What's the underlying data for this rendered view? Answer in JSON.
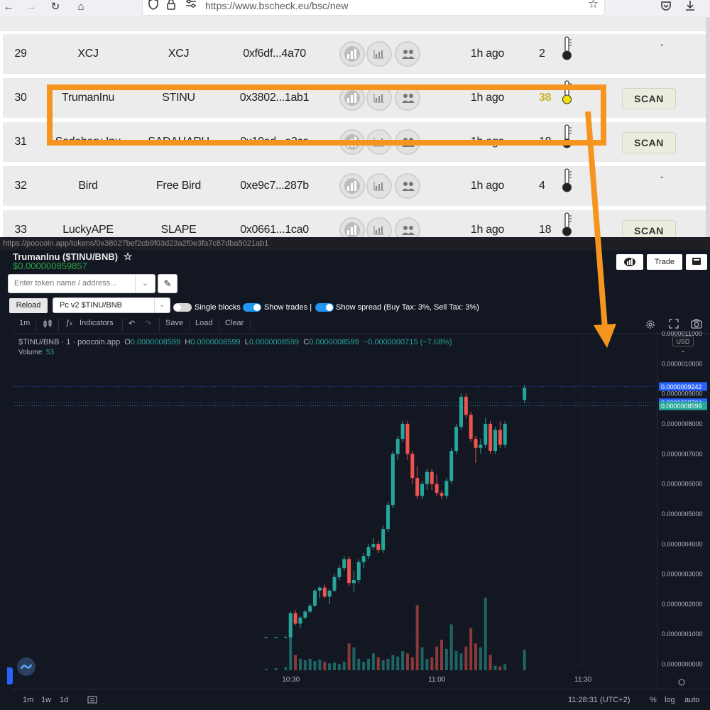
{
  "browser": {
    "url": "https://www.bscheck.eu/bsc/new"
  },
  "bscheck": {
    "rows": [
      {
        "num": "29",
        "name": "XCJ",
        "symbol": "XCJ",
        "address": "0xf6df...4a70",
        "age": "1h ago",
        "score": "2",
        "scan": "-"
      },
      {
        "num": "30",
        "name": "TrumanInu",
        "symbol": "STINU",
        "address": "0x3802...1ab1",
        "age": "1h ago",
        "score": "38",
        "scan": "SCAN"
      },
      {
        "num": "31",
        "name": "Sadaharu Inu",
        "symbol": "SADAHARU",
        "address": "0x10ad...a2ca",
        "age": "1h ago",
        "score": "18",
        "scan": "SCAN"
      },
      {
        "num": "32",
        "name": "Bird",
        "symbol": "Free Bird",
        "address": "0xe9c7...287b",
        "age": "1h ago",
        "score": "4",
        "scan": "-"
      },
      {
        "num": "33",
        "name": "LuckyAPE",
        "symbol": "SLAPE",
        "address": "0x0661...1ca0",
        "age": "1h ago",
        "score": "18",
        "scan": "SCAN"
      }
    ],
    "highlight_color": "#f5951f",
    "hot_score_color": "#c9b52a"
  },
  "poocoin": {
    "url": "https://poocoin.app/tokens/0x38027bef2cb9f03d23a2f0e3fa7c87dba5021ab1",
    "title": "TrumanInu ($TINU/BNB)",
    "price": "$0.000000859857",
    "token_search_placeholder": "Enter token name / address...",
    "reload_label": "Reload",
    "pair_selected": "Pc v2 $TINU/BNB",
    "toggles": [
      {
        "label": "Single blocks",
        "on": false
      },
      {
        "label": "Show trades |",
        "on": true
      },
      {
        "label": "Show spread (Buy Tax: 3%, Sell Tax: 3%)",
        "on": true
      }
    ],
    "trade_label": "Trade",
    "chart_toolbar": {
      "interval": "1m",
      "indicators": "Indicators",
      "save": "Save",
      "load": "Load",
      "clear": "Clear"
    },
    "legend": {
      "symbol": "$TINU/BNB · 1 · poocoin.app",
      "o_label": "O",
      "o": "0.0000008599",
      "h_label": "H",
      "h": "0.0000008599",
      "l_label": "L",
      "l": "0.0000008599",
      "c_label": "C",
      "c": "0.0000008599",
      "change": "−0.0000000715 (−7.68%)",
      "volume_label": "Volume",
      "volume": "53"
    },
    "currency": "USD",
    "bottom": {
      "ranges": [
        "1m",
        "1w",
        "1d"
      ],
      "clock": "11:28:31 (UTC+2)",
      "percent": "%",
      "log": "log",
      "auto": "auto"
    },
    "price_tags": [
      "0.0000009242",
      "0.0000008704",
      "0.0000008599"
    ],
    "colors": {
      "up": "#26a69a",
      "down": "#ef5350",
      "tag_blue": "#2962ff",
      "tag_green": "#26a69a"
    }
  },
  "chart_data": {
    "type": "candlestick",
    "y_tick_labels": [
      "0.0000011000",
      "0.0000010000",
      "0.0000009000",
      "0.0000008000",
      "0.0000007000",
      "0.0000006000",
      "0.0000005000",
      "0.0000004000",
      "0.0000003000",
      "0.0000002000",
      "0.0000001000",
      "0.0000000000"
    ],
    "ylim": [
      -2e-08,
      1.1e-06
    ],
    "x_tick_labels": [
      "10:30",
      "11:00",
      "11:30"
    ],
    "x_ticks_minutes": [
      0,
      30,
      60
    ],
    "xlim_minutes": [
      -57,
      75
    ],
    "candles": [
      {
        "t": -5,
        "o": 9e-08,
        "h": 9.2e-08,
        "l": 8.8e-08,
        "c": 9e-08,
        "v": 4
      },
      {
        "t": -3,
        "o": 9e-08,
        "h": 9.2e-08,
        "l": 8.8e-08,
        "c": 9e-08,
        "v": 5
      },
      {
        "t": -1,
        "o": 9e-08,
        "h": 9.5e-08,
        "l": 8.8e-08,
        "c": 9e-08,
        "v": 8
      },
      {
        "t": 0,
        "o": 9e-08,
        "h": 1.75e-07,
        "l": 9e-08,
        "c": 1.7e-07,
        "v": 110
      },
      {
        "t": 1,
        "o": 1.7e-07,
        "h": 1.8e-07,
        "l": 1.3e-07,
        "c": 1.35e-07,
        "v": 40
      },
      {
        "t": 2,
        "o": 1.35e-07,
        "h": 1.6e-07,
        "l": 1.2e-07,
        "c": 1.55e-07,
        "v": 30
      },
      {
        "t": 3,
        "o": 1.55e-07,
        "h": 1.8e-07,
        "l": 1.5e-07,
        "c": 1.75e-07,
        "v": 26
      },
      {
        "t": 4,
        "o": 1.75e-07,
        "h": 2e-07,
        "l": 1.7e-07,
        "c": 1.95e-07,
        "v": 30
      },
      {
        "t": 5,
        "o": 1.95e-07,
        "h": 2.5e-07,
        "l": 1.9e-07,
        "c": 2.45e-07,
        "v": 24
      },
      {
        "t": 6,
        "o": 2.45e-07,
        "h": 2.6e-07,
        "l": 2.2e-07,
        "c": 2.55e-07,
        "v": 28
      },
      {
        "t": 7,
        "o": 2.55e-07,
        "h": 2.65e-07,
        "l": 2.2e-07,
        "c": 2.25e-07,
        "v": 22
      },
      {
        "t": 8,
        "o": 2.25e-07,
        "h": 2.5e-07,
        "l": 2e-07,
        "c": 2.45e-07,
        "v": 18
      },
      {
        "t": 9,
        "o": 2.45e-07,
        "h": 3e-07,
        "l": 2.4e-07,
        "c": 2.9e-07,
        "v": 20
      },
      {
        "t": 10,
        "o": 2.9e-07,
        "h": 3.3e-07,
        "l": 2.8e-07,
        "c": 3.2e-07,
        "v": 16
      },
      {
        "t": 11,
        "o": 3.2e-07,
        "h": 3.6e-07,
        "l": 3.1e-07,
        "c": 3.5e-07,
        "v": 22
      },
      {
        "t": 12,
        "o": 3.5e-07,
        "h": 3.6e-07,
        "l": 2.6e-07,
        "c": 2.7e-07,
        "v": 70
      },
      {
        "t": 13,
        "o": 2.7e-07,
        "h": 3.1e-07,
        "l": 2.4e-07,
        "c": 2.8e-07,
        "v": 60
      },
      {
        "t": 14,
        "o": 2.8e-07,
        "h": 3.5e-07,
        "l": 2.7e-07,
        "c": 3.4e-07,
        "v": 30
      },
      {
        "t": 15,
        "o": 3.4e-07,
        "h": 3.7e-07,
        "l": 3.2e-07,
        "c": 3.6e-07,
        "v": 22
      },
      {
        "t": 16,
        "o": 3.6e-07,
        "h": 4e-07,
        "l": 3.5e-07,
        "c": 3.9e-07,
        "v": 30
      },
      {
        "t": 17,
        "o": 3.9e-07,
        "h": 4.2e-07,
        "l": 3.8e-07,
        "c": 4e-07,
        "v": 44
      },
      {
        "t": 18,
        "o": 4e-07,
        "h": 4.1e-07,
        "l": 3.7e-07,
        "c": 3.8e-07,
        "v": 34
      },
      {
        "t": 19,
        "o": 3.8e-07,
        "h": 4.6e-07,
        "l": 3.7e-07,
        "c": 4.5e-07,
        "v": 26
      },
      {
        "t": 20,
        "o": 4.5e-07,
        "h": 5.4e-07,
        "l": 4.4e-07,
        "c": 5.3e-07,
        "v": 30
      },
      {
        "t": 21,
        "o": 5.3e-07,
        "h": 7.1e-07,
        "l": 5.2e-07,
        "c": 7e-07,
        "v": 40
      },
      {
        "t": 22,
        "o": 7e-07,
        "h": 7.6e-07,
        "l": 6.8e-07,
        "c": 7.5e-07,
        "v": 36
      },
      {
        "t": 23,
        "o": 7.5e-07,
        "h": 8.1e-07,
        "l": 7.4e-07,
        "c": 8e-07,
        "v": 50
      },
      {
        "t": 24,
        "o": 8e-07,
        "h": 8.1e-07,
        "l": 6.8e-07,
        "c": 7e-07,
        "v": 44
      },
      {
        "t": 25,
        "o": 7e-07,
        "h": 7.1e-07,
        "l": 6e-07,
        "c": 6.2e-07,
        "v": 34
      },
      {
        "t": 26,
        "o": 6.2e-07,
        "h": 6.6e-07,
        "l": 5.5e-07,
        "c": 5.6e-07,
        "v": 170
      },
      {
        "t": 27,
        "o": 5.6e-07,
        "h": 6.1e-07,
        "l": 5.5e-07,
        "c": 6e-07,
        "v": 60
      },
      {
        "t": 28,
        "o": 6e-07,
        "h": 6.5e-07,
        "l": 5.8e-07,
        "c": 6.4e-07,
        "v": 30
      },
      {
        "t": 29,
        "o": 6.4e-07,
        "h": 6.5e-07,
        "l": 5.8e-07,
        "c": 6e-07,
        "v": 34
      },
      {
        "t": 30,
        "o": 6e-07,
        "h": 6.3e-07,
        "l": 5.6e-07,
        "c": 5.7e-07,
        "v": 62
      },
      {
        "t": 31,
        "o": 5.7e-07,
        "h": 5.8e-07,
        "l": 5.5e-07,
        "c": 5.6e-07,
        "v": 80
      },
      {
        "t": 32,
        "o": 5.6e-07,
        "h": 6.2e-07,
        "l": 5.5e-07,
        "c": 6.1e-07,
        "v": 56
      },
      {
        "t": 33,
        "o": 6.1e-07,
        "h": 7.2e-07,
        "l": 6e-07,
        "c": 7.1e-07,
        "v": 120
      },
      {
        "t": 34,
        "o": 7.1e-07,
        "h": 8e-07,
        "l": 7e-07,
        "c": 7.9e-07,
        "v": 50
      },
      {
        "t": 35,
        "o": 7.9e-07,
        "h": 9e-07,
        "l": 7.8e-07,
        "c": 8.9e-07,
        "v": 44
      },
      {
        "t": 36,
        "o": 8.9e-07,
        "h": 9e-07,
        "l": 8.2e-07,
        "c": 8.3e-07,
        "v": 62
      },
      {
        "t": 37,
        "o": 8.3e-07,
        "h": 8.4e-07,
        "l": 7.4e-07,
        "c": 7.5e-07,
        "v": 110
      },
      {
        "t": 38,
        "o": 7.5e-07,
        "h": 7.6e-07,
        "l": 6.7e-07,
        "c": 7.2e-07,
        "v": 70
      },
      {
        "t": 39,
        "o": 7.2e-07,
        "h": 7.5e-07,
        "l": 7e-07,
        "c": 7.3e-07,
        "v": 60
      },
      {
        "t": 40,
        "o": 7.3e-07,
        "h": 8.2e-07,
        "l": 7.2e-07,
        "c": 8e-07,
        "v": 190
      },
      {
        "t": 41,
        "o": 8e-07,
        "h": 8.1e-07,
        "l": 7e-07,
        "c": 7.1e-07,
        "v": 40
      },
      {
        "t": 42,
        "o": 7.1e-07,
        "h": 7.9e-07,
        "l": 7e-07,
        "c": 7.8e-07,
        "v": 12
      },
      {
        "t": 43,
        "o": 7.8e-07,
        "h": 8.1e-07,
        "l": 7.2e-07,
        "c": 7.3e-07,
        "v": 10
      },
      {
        "t": 44,
        "o": 7.3e-07,
        "h": 8.1e-07,
        "l": 7.2e-07,
        "c": 8e-07,
        "v": 16
      },
      {
        "t": 48,
        "o": 8.8e-07,
        "h": 9.3e-07,
        "l": 8.7e-07,
        "c": 9.2e-07,
        "v": 53
      }
    ]
  }
}
